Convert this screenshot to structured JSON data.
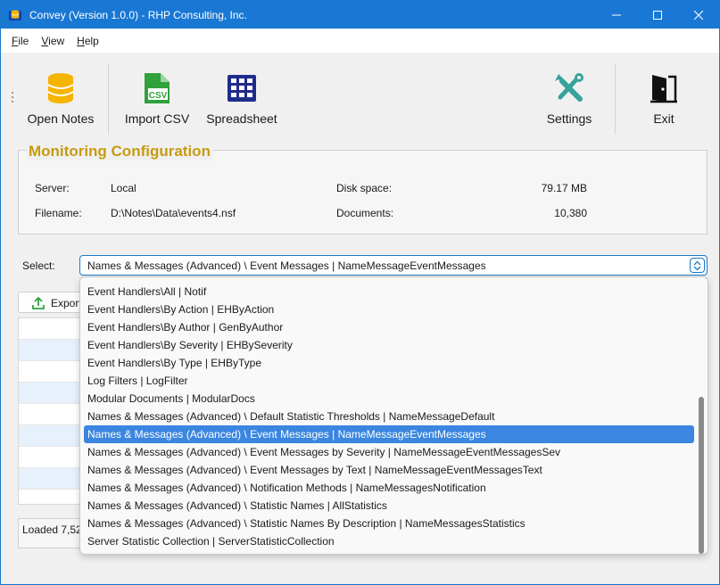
{
  "window": {
    "title": "Convey (Version 1.0.0) - RHP Consulting, Inc."
  },
  "menu": {
    "items": [
      {
        "label": "File",
        "accel": "F",
        "rest": "ile"
      },
      {
        "label": "View",
        "accel": "V",
        "rest": "iew"
      },
      {
        "label": "Help",
        "accel": "H",
        "rest": "elp"
      }
    ]
  },
  "toolbar": {
    "open_notes": "Open Notes",
    "import_csv": "Import CSV",
    "csv_badge": "CSV",
    "spreadsheet": "Spreadsheet",
    "settings": "Settings",
    "exit": "Exit"
  },
  "colors": {
    "accent": "#1978d4",
    "group_title": "#c79a11",
    "selection": "#3a86e0",
    "database_icon": "#f5b400",
    "csv_icon": "#2fa23c",
    "spreadsheet_icon": "#1f2c8a",
    "settings_icon": "#35a39a"
  },
  "config": {
    "title": "Monitoring Configuration",
    "server_label": "Server:",
    "server_value": "Local",
    "filename_label": "Filename:",
    "filename_value": "D:\\Notes\\Data\\events4.nsf",
    "disk_label": "Disk space:",
    "disk_value": "79.17 MB",
    "documents_label": "Documents:",
    "documents_value": "10,380"
  },
  "select": {
    "label": "Select:",
    "value": "Names & Messages (Advanced) \\ Event Messages | NameMessageEventMessages"
  },
  "export": {
    "label": "Export"
  },
  "status": {
    "text": "Loaded 7,52"
  },
  "dropdown": {
    "items": [
      {
        "label": "Event Handlers\\All | Notif",
        "selected": false
      },
      {
        "label": "Event Handlers\\By Action | EHByAction",
        "selected": false
      },
      {
        "label": "Event Handlers\\By Author | GenByAuthor",
        "selected": false
      },
      {
        "label": "Event Handlers\\By Severity | EHBySeverity",
        "selected": false
      },
      {
        "label": "Event Handlers\\By Type | EHByType",
        "selected": false
      },
      {
        "label": "Log Filters | LogFilter",
        "selected": false
      },
      {
        "label": "Modular Documents | ModularDocs",
        "selected": false
      },
      {
        "label": "Names & Messages (Advanced) \\ Default Statistic Thresholds | NameMessageDefault",
        "selected": false
      },
      {
        "label": "Names & Messages (Advanced) \\ Event Messages | NameMessageEventMessages",
        "selected": true
      },
      {
        "label": "Names & Messages (Advanced) \\ Event Messages by Severity | NameMessageEventMessagesSev",
        "selected": false
      },
      {
        "label": "Names & Messages (Advanced) \\ Event Messages by Text | NameMessageEventMessagesText",
        "selected": false
      },
      {
        "label": "Names & Messages (Advanced) \\ Notification Methods | NameMessagesNotification",
        "selected": false
      },
      {
        "label": "Names & Messages (Advanced) \\ Statistic Names | AllStatistics",
        "selected": false
      },
      {
        "label": "Names & Messages (Advanced) \\ Statistic Names By Description | NameMessagesStatistics",
        "selected": false
      },
      {
        "label": "Server Statistic Collection | ServerStatisticCollection",
        "selected": false
      }
    ]
  }
}
